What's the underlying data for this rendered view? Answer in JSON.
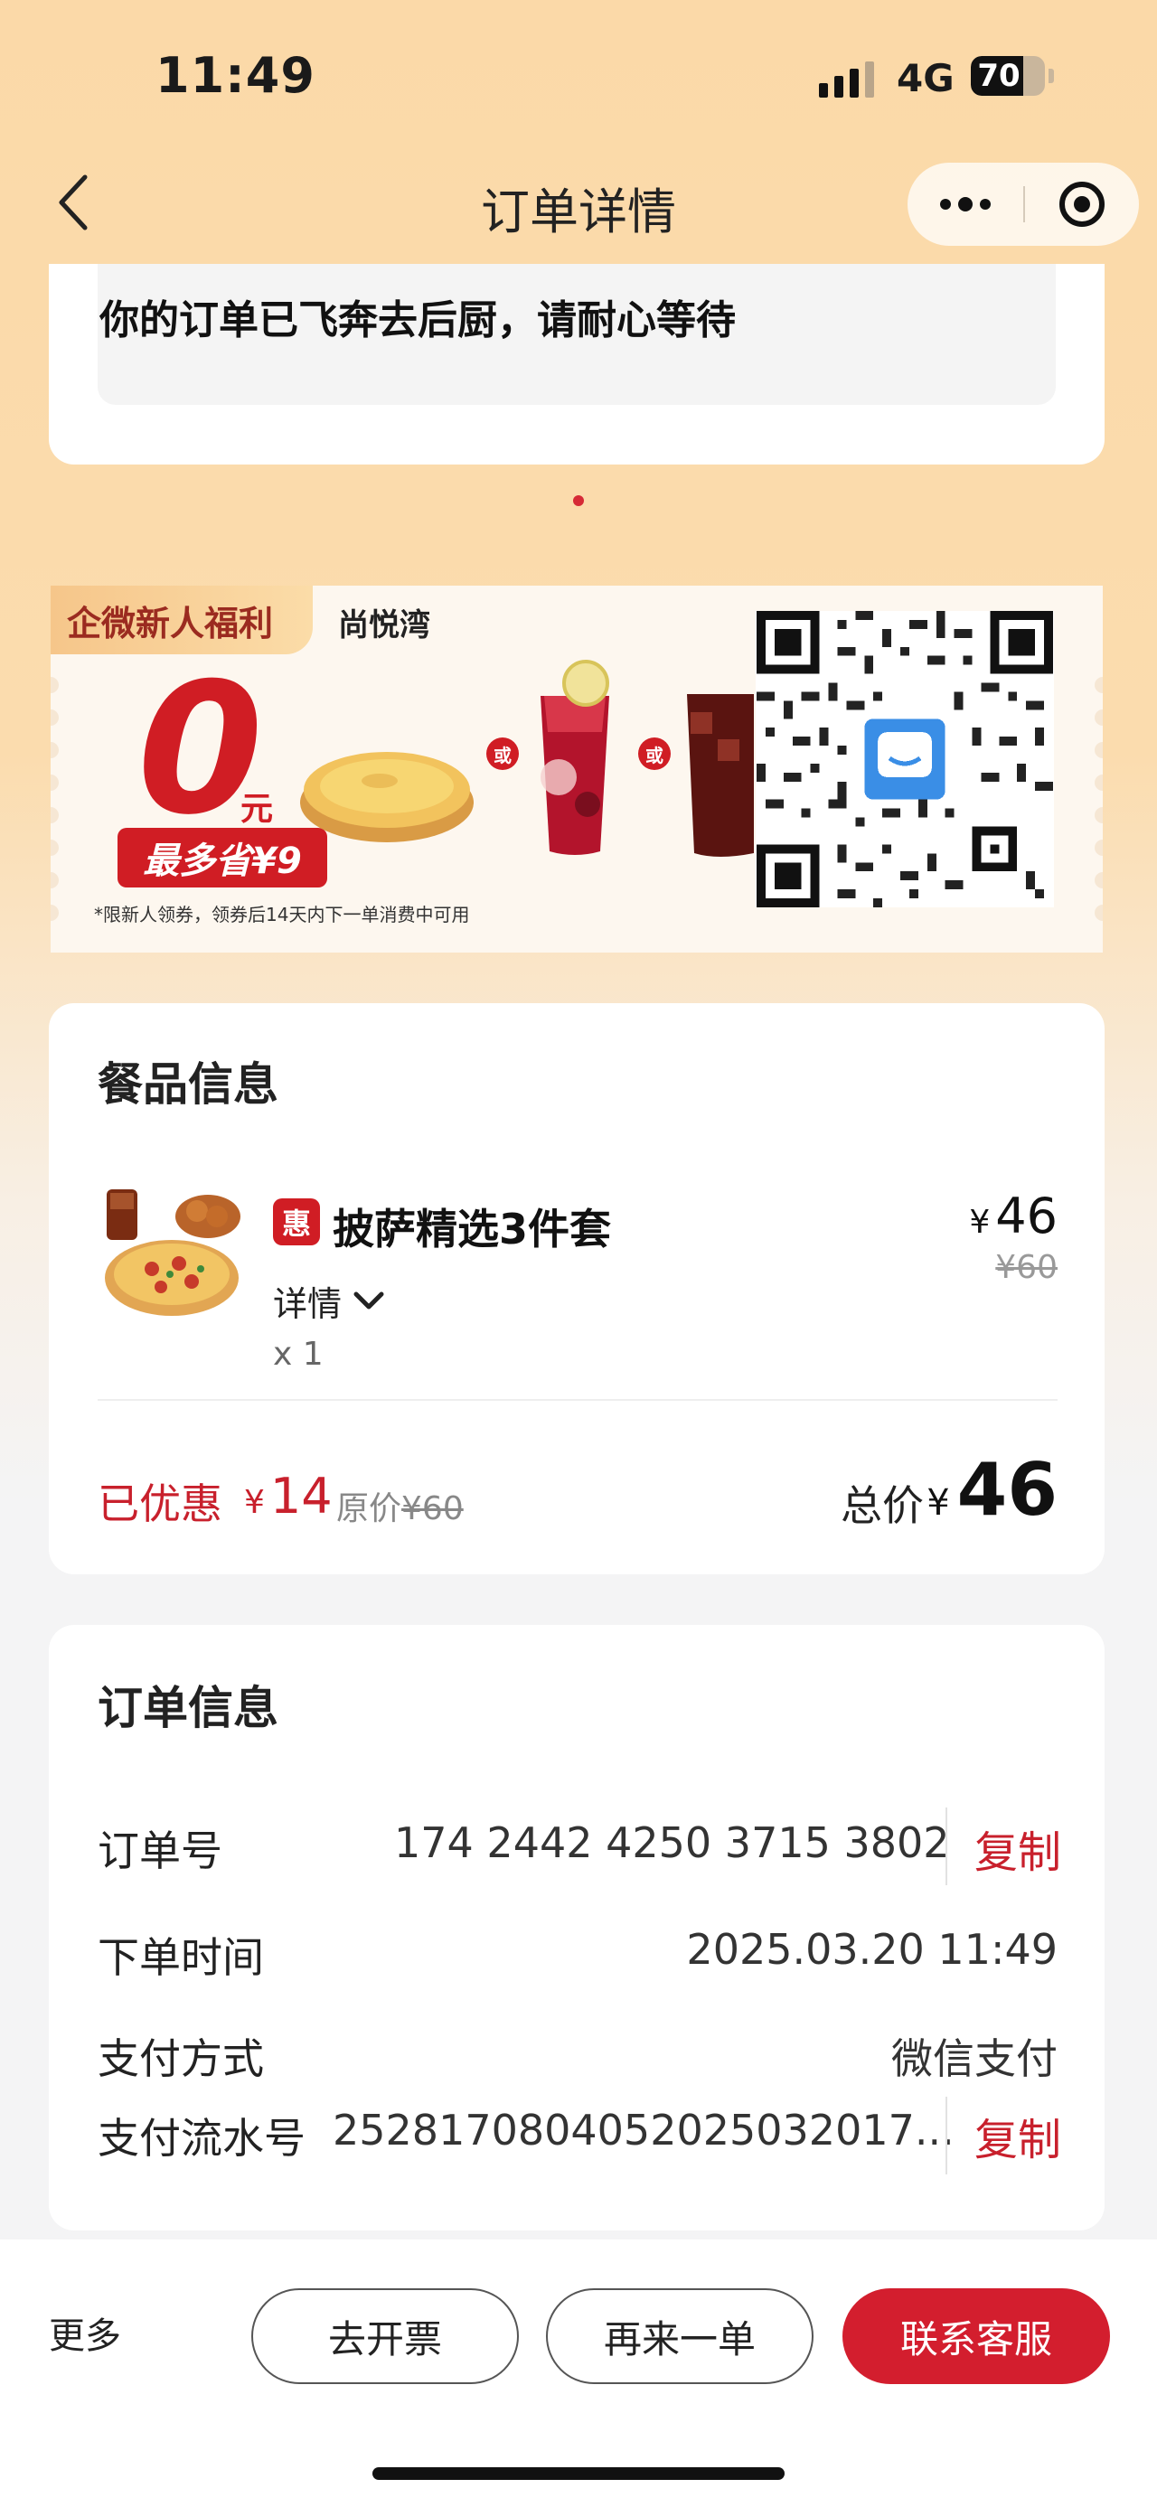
{
  "status_bar": {
    "time": "11:49",
    "network": "4G",
    "battery": "70",
    "battery_level": 0.7,
    "signal_bars": 3
  },
  "nav": {
    "title": "订单详情",
    "back_icon": "chevron-left-icon",
    "more_icon": "ellipsis-icon",
    "close_icon": "target-icon"
  },
  "order_status": {
    "message": "你的订单已飞奔去后厨，请耐心等待"
  },
  "promo": {
    "tag": "企微新人福利",
    "store": "尚悦湾",
    "zero": "0",
    "yuan": "元",
    "save_badge": "最多省¥9",
    "or_text": "或",
    "note": "*限新人领券，领券后14天内下一单消费中可用"
  },
  "items_card": {
    "title": "餐品信息",
    "items": [
      {
        "badge": "惠",
        "name": "披萨精选3件套",
        "detail_label": "详情",
        "qty": "x 1",
        "currency": "¥",
        "price": "46",
        "original_price": "¥60"
      }
    ],
    "discount_label": "已优惠",
    "discount_currency": "¥",
    "discount_amount": "14",
    "original_label": "原价",
    "original_total": "¥60",
    "total_label": "总价",
    "total_currency": "¥",
    "total": "46"
  },
  "order_info": {
    "title": "订单信息",
    "order_no_label": "订单号",
    "order_no": "174 2442 4250 3715 3802",
    "copy_label": "复制",
    "time_label": "下单时间",
    "time": "2025.03.20 11:49",
    "pay_method_label": "支付方式",
    "pay_method": "微信支付",
    "serial_label": "支付流水号",
    "serial": "2528170804052025032017..."
  },
  "bottom_bar": {
    "more": "更多",
    "invoice": "去开票",
    "reorder": "再来一单",
    "contact": "联系客服"
  },
  "colors": {
    "accent_red": "#d31e2e",
    "header_bg": "#fbd9a8"
  }
}
